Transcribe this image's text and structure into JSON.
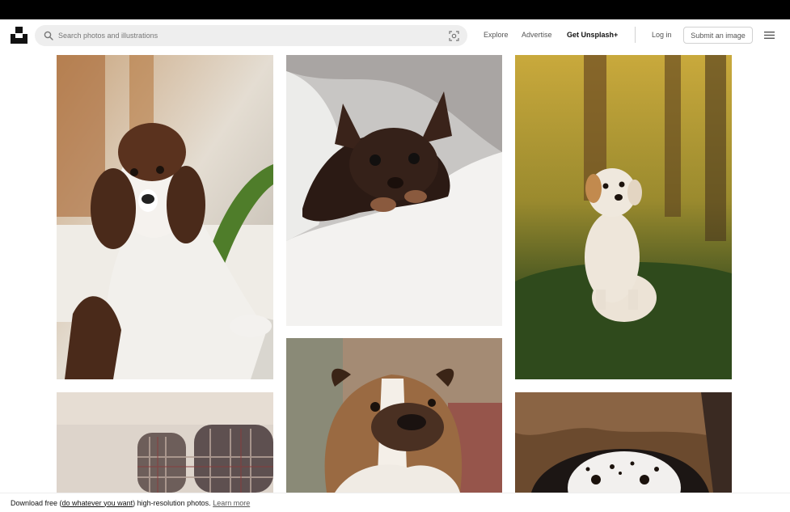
{
  "brand": {
    "logo_icon": "unsplash-logo-icon"
  },
  "search": {
    "placeholder": "Search photos and illustrations",
    "value": ""
  },
  "nav": {
    "explore": "Explore",
    "advertise": "Advertise",
    "get_plus": "Get Unsplash+",
    "login": "Log in",
    "submit": "Submit an image"
  },
  "icons": {
    "search": "search-icon",
    "visual_search": "visual-search-icon",
    "menu": "hamburger-menu-icon"
  },
  "photos": [
    {
      "subject": "springer-spaniel-puppy",
      "colors": [
        "#6b3a1f",
        "#e8e2d8"
      ]
    },
    {
      "subject": "chihuahua-in-blanket",
      "colors": [
        "#2b1a14",
        "#f1efec"
      ]
    },
    {
      "subject": "cavapoo-in-forest",
      "colors": [
        "#a8892d",
        "#2f3a1a"
      ]
    },
    {
      "subject": "plaid-chair",
      "colors": [
        "#d9cfc6",
        "#6a5c57"
      ]
    },
    {
      "subject": "bulldog-portrait",
      "colors": [
        "#9a6a42",
        "#f0ede8"
      ]
    },
    {
      "subject": "dalmatian-peeking",
      "colors": [
        "#6b4a2e",
        "#f2f2f2"
      ]
    }
  ],
  "footer": {
    "prefix": "Download free (",
    "link": "do whatever you want",
    "suffix": ") high-resolution photos.",
    "learn_more": "Learn more"
  }
}
